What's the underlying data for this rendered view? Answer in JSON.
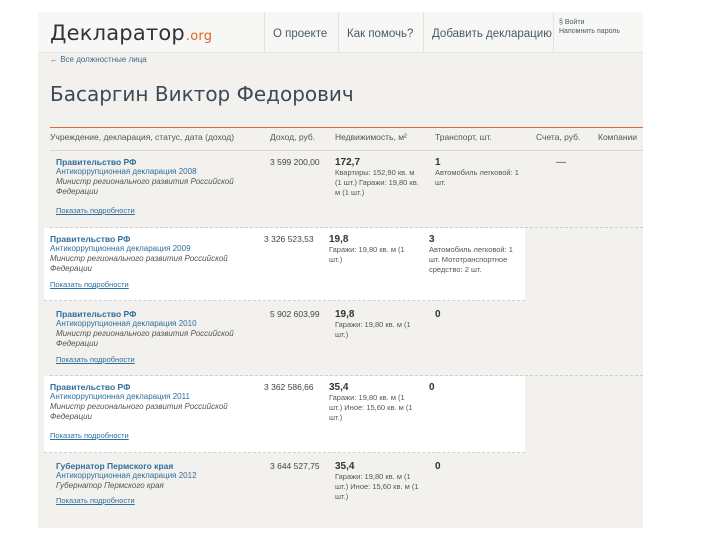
{
  "header": {
    "logo_main": "Декларатор",
    "logo_tld": ".org",
    "nav": [
      "О проекте",
      "Как помочь?",
      "Добавить декларацию"
    ],
    "login_line1": "Войти",
    "login_line2": "Напомнить пароль"
  },
  "back_link": "← Все должностные лица",
  "person_name": "Басаргин Виктор Федорович",
  "table": {
    "headers": [
      "Учреждение, декларация, статус, дата (доход)",
      "Доход, руб.",
      "Недвижимость, м²",
      "Транспорт, шт.",
      "Счета, руб.",
      "Компании"
    ],
    "details_label": "Показать подробности",
    "rows": [
      {
        "org": "Правительство РФ",
        "decl": "Антикоррупционная декларация 2008",
        "position": "Министр регионального развития Российской Федерации",
        "income": "3 599 200,00",
        "realty_total": "172,7",
        "realty_detail": "Квартиры: 152,90 кв. м (1 шт.) Гаражи: 19,80 кв. м (1 шт.)",
        "transport_count": "1",
        "transport_detail": "Автомобиль легковой: 1 шт.",
        "accounts": "—"
      },
      {
        "org": "Правительство РФ",
        "decl": "Антикоррупционная декларация 2009",
        "position": "Министр регионального развития Российской Федерации",
        "income": "3 326 523,53",
        "realty_total": "19,8",
        "realty_detail": "Гаражи: 19,80 кв. м (1 шт.)",
        "transport_count": "3",
        "transport_detail": "Автомобиль легковой: 1 шт. Мототранспортное средство: 2 шт.",
        "accounts": ""
      },
      {
        "org": "Правительство РФ",
        "decl": "Антикоррупционная декларация 2010",
        "position": "Министр регионального развития Российской Федерации",
        "income": "5 902 603,99",
        "realty_total": "19,8",
        "realty_detail": "Гаражи: 19,80 кв. м (1 шт.)",
        "transport_count": "0",
        "transport_detail": "",
        "accounts": ""
      },
      {
        "org": "Правительство РФ",
        "decl": "Антикоррупционная декларация 2011",
        "position": "Министр регионального развития Российской Федерации",
        "income": "3 362 586,66",
        "realty_total": "35,4",
        "realty_detail": "Гаражи: 19,80 кв. м (1 шт.) Иное: 15,60 кв. м (1 шт.)",
        "transport_count": "0",
        "transport_detail": "",
        "accounts": ""
      },
      {
        "org": "Губернатор Пермского края",
        "decl": "Антикоррупционная декларация 2012",
        "position": "Губернатор Пермского края",
        "income": "3 644 527,75",
        "realty_total": "35,4",
        "realty_detail": "Гаражи: 19,80 кв. м (1 шт.) Иное: 15,60 кв. м (1 шт.)",
        "transport_count": "0",
        "transport_detail": "",
        "accounts": ""
      }
    ]
  }
}
